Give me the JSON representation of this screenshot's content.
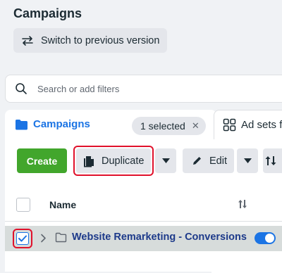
{
  "page": {
    "title": "Campaigns"
  },
  "switch_version": {
    "label": "Switch to previous version",
    "icon": "swap-arrows-icon"
  },
  "search": {
    "placeholder": "Search or add filters",
    "icon": "search-icon"
  },
  "tabs": {
    "campaigns": {
      "label": "Campaigns",
      "icon": "folder-icon",
      "color": "#1b74e4"
    },
    "ad_sets": {
      "label": "Ad sets fo",
      "icon": "grid-icon"
    }
  },
  "selection": {
    "label": "1 selected",
    "close": "✕"
  },
  "toolbar": {
    "create_label": "Create",
    "create_color": "#42a62c",
    "duplicate_label": "Duplicate",
    "edit_label": "Edit",
    "highlight_color": "#e0112b"
  },
  "table": {
    "header": {
      "name_label": "Name"
    },
    "rows": [
      {
        "name": "Website Remarketing - Conversions",
        "selected": true,
        "status": "on"
      }
    ]
  }
}
